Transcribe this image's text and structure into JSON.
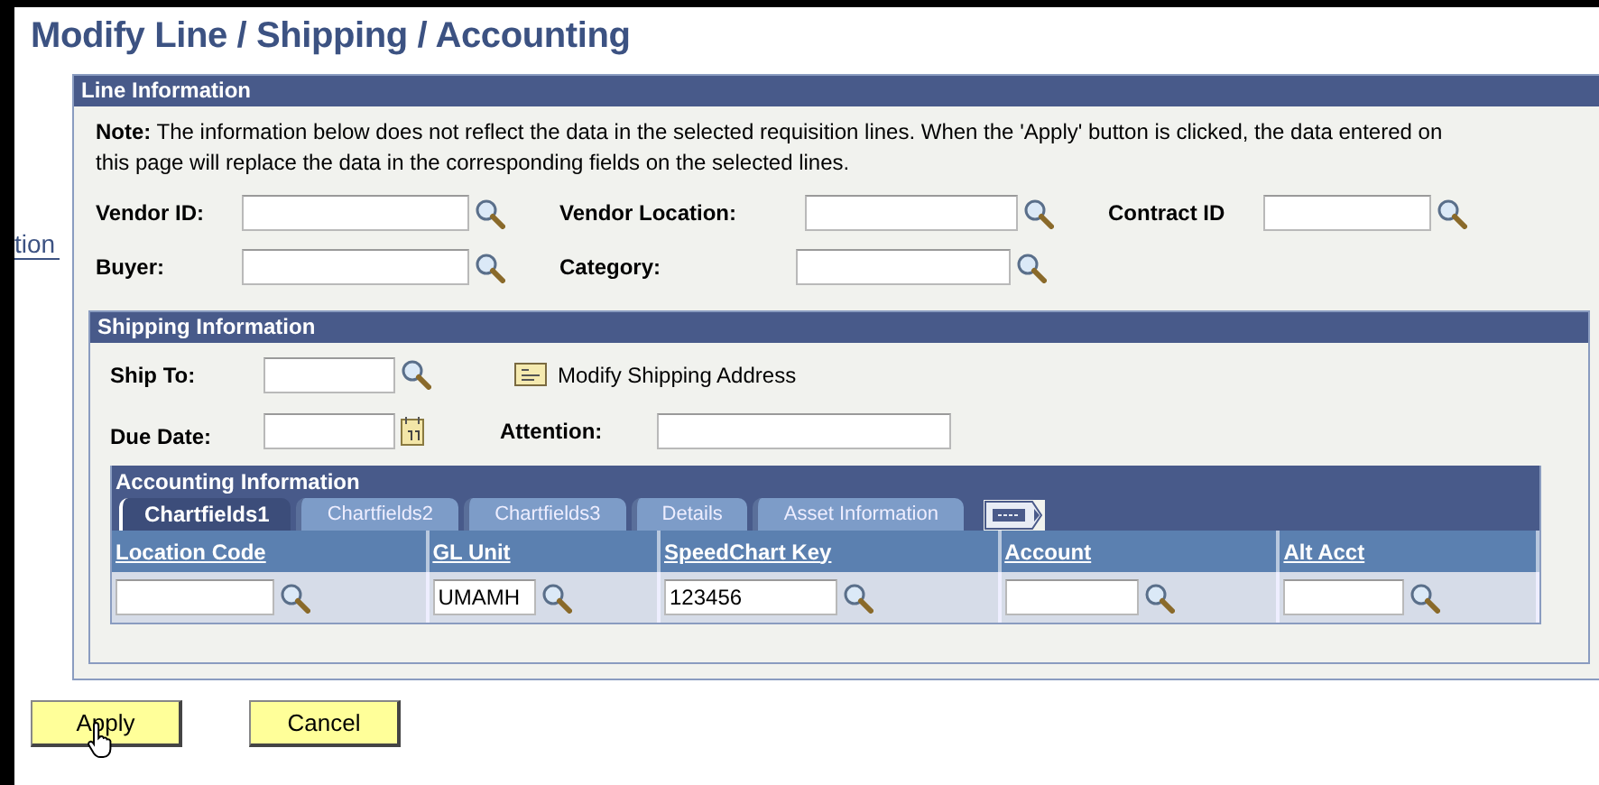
{
  "page_title": "Modify Line / Shipping / Accounting",
  "side_link": "tion",
  "line_information": {
    "title": "Line Information",
    "note": "**Note:** The information below does not reflect the data in the selected requisition lines. When the 'Apply' button is clicked, the data entered on this page will replace the data in the corresponding fields on the selected lines.",
    "rows": [
      [
        {
          "label": "Vendor ID:",
          "kind": "lookup"
        },
        {
          "label": "Vendor Location:",
          "kind": "lookup"
        },
        {
          "label": "Contract ID",
          "kind": "lookup"
        }
      ],
      [
        {
          "label": "Buyer:",
          "kind": "lookup"
        },
        {
          "label": "Category:",
          "kind": "lookup"
        }
      ]
    ]
  },
  "shipping_information": {
    "title": "Shipping Information",
    "rows": [
      [
        {
          "label": "Ship To:",
          "kind": "lookup"
        },
        {
          "label": "Modify Shipping Address",
          "kind": "link"
        }
      ],
      [
        {
          "label": "Due Date:",
          "kind": "date"
        },
        {
          "label": "Attention:",
          "kind": "text"
        }
      ]
    ]
  },
  "accounting_information": {
    "title": "Accounting Information",
    "tabs": [
      {
        "label": "Chartfields1",
        "selected": true
      },
      {
        "label": "Chartfields2",
        "selected": false
      },
      {
        "label": "Chartfields3",
        "selected": false
      },
      {
        "label": "Details",
        "selected": false
      },
      {
        "label": "Asset Information",
        "selected": false
      }
    ],
    "table": {
      "columns": [
        "Location Code",
        "GL Unit",
        "SpeedChart Key",
        "Account",
        "Alt Acct"
      ],
      "rows": [
        [
          {
            "kind": "lookup"
          },
          {
            "value": "UMAMH",
            "kind": "lookup"
          },
          {
            "value": "123456",
            "kind": "lookup"
          },
          {
            "kind": "lookup"
          },
          {
            "kind": "lookup"
          }
        ]
      ]
    }
  },
  "buttons": [
    "Apply",
    "Cancel"
  ]
}
